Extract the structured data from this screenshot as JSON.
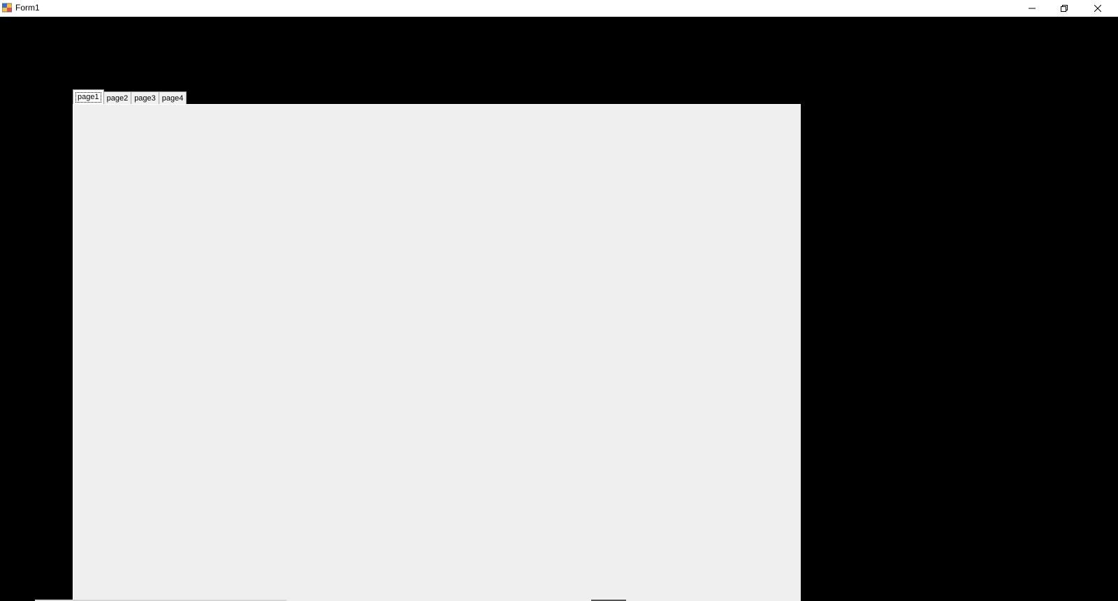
{
  "window": {
    "title": "Form1",
    "background_color": "#000000"
  },
  "titlebar": {
    "icon": "winforms-app-icon",
    "minimize_icon": "minimize-icon",
    "restore_icon": "restore-icon",
    "close_icon": "close-icon"
  },
  "tabs": [
    {
      "label": "page1",
      "selected": true
    },
    {
      "label": "page2",
      "selected": false
    },
    {
      "label": "page3",
      "selected": false
    },
    {
      "label": "page4",
      "selected": false
    }
  ],
  "tabpage": {
    "background_color": "#efefef"
  }
}
